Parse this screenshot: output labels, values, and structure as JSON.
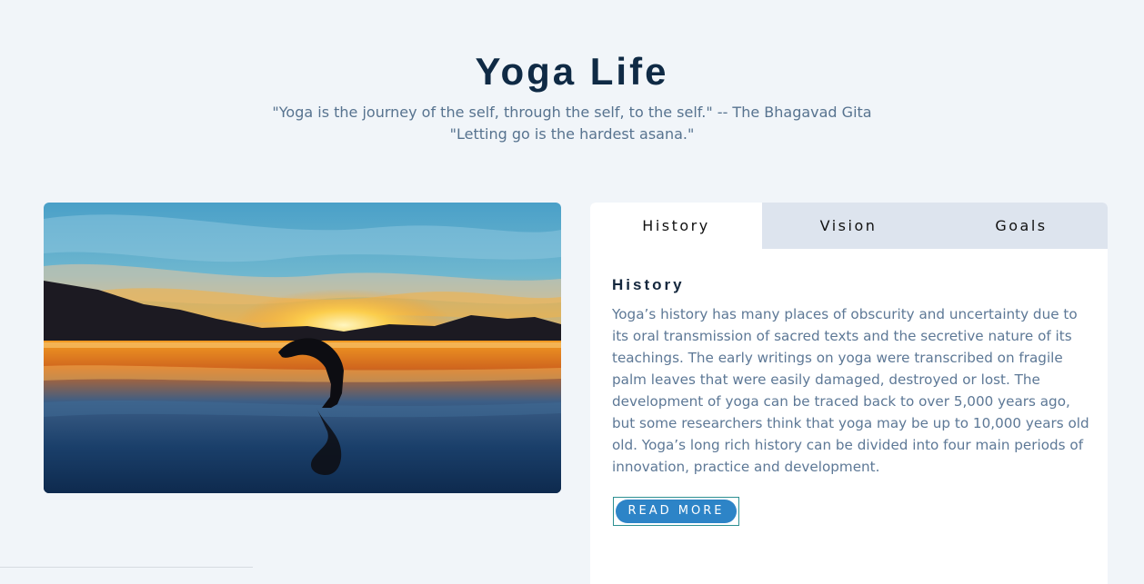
{
  "header": {
    "title": "Yoga Life",
    "quotes": [
      "\"Yoga is the journey of the self, through the self, to the self.\" -- The Bhagavad Gita",
      "\"Letting go is the hardest asana.\""
    ]
  },
  "hero_image": {
    "description_icon": "sunset-yoga-photo"
  },
  "tabs": [
    {
      "label": "History",
      "active": true
    },
    {
      "label": "Vision",
      "active": false
    },
    {
      "label": "Goals",
      "active": false
    }
  ],
  "content": {
    "heading": "History",
    "body": "Yoga’s history has many places of obscurity and uncertainty due to its oral transmission of sacred texts and the secretive nature of its teachings. The early writings on yoga were transcribed on fragile palm leaves that were easily damaged, destroyed or lost. The development of yoga can be traced back to over 5,000 years ago, but some researchers think that yoga may be up to 10,000 years old old. Yoga’s long rich history can be divided into four main periods of innovation, practice and development.",
    "button_label": "READ MORE"
  },
  "colors": {
    "background": "#f1f5f9",
    "title": "#0f2a45",
    "text": "#57738f",
    "tab_inactive": "#dde4ee",
    "button": "#2d84c7"
  }
}
